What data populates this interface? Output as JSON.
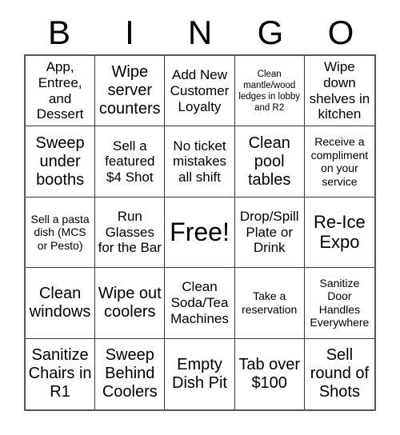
{
  "card": {
    "header_letters": [
      "B",
      "I",
      "N",
      "G",
      "O"
    ],
    "rows": [
      [
        {
          "text": "App, Entree, and Dessert",
          "size": "md"
        },
        {
          "text": "Wipe server counters",
          "size": "lg"
        },
        {
          "text": "Add New Customer Loyalty",
          "size": "md"
        },
        {
          "text": "Clean mantle/wood ledges in lobby and R2",
          "size": "xs"
        },
        {
          "text": "Wipe down shelves in kitchen",
          "size": "md"
        }
      ],
      [
        {
          "text": "Sweep under booths",
          "size": "lg"
        },
        {
          "text": "Sell a featured $4 Shot",
          "size": "md"
        },
        {
          "text": "No ticket mistakes all shift",
          "size": "md"
        },
        {
          "text": "Clean pool tables",
          "size": "lg"
        },
        {
          "text": "Receive a compliment on your service",
          "size": "sm"
        }
      ],
      [
        {
          "text": "Sell a pasta dish (MCS or Pesto)",
          "size": "sm"
        },
        {
          "text": "Run Glasses for the Bar",
          "size": "md"
        },
        {
          "text": "Free!",
          "size": "xxl"
        },
        {
          "text": "Drop/Spill Plate or Drink",
          "size": "md"
        },
        {
          "text": "Re-Ice Expo",
          "size": "xl"
        }
      ],
      [
        {
          "text": "Clean windows",
          "size": "lg"
        },
        {
          "text": "Wipe out coolers",
          "size": "lg"
        },
        {
          "text": "Clean Soda/Tea Machines",
          "size": "md"
        },
        {
          "text": "Take a reservation",
          "size": "sm"
        },
        {
          "text": "Sanitize Door Handles Everywhere",
          "size": "sm"
        }
      ],
      [
        {
          "text": "Sanitize Chairs in R1",
          "size": "lg"
        },
        {
          "text": "Sweep Behind Coolers",
          "size": "lg"
        },
        {
          "text": "Empty Dish Pit",
          "size": "lg"
        },
        {
          "text": "Tab over $100",
          "size": "lg"
        },
        {
          "text": "Sell round of Shots",
          "size": "lg"
        }
      ]
    ]
  },
  "colors": {
    "background": "#ffffff",
    "text": "#000000",
    "grid_line": "#3a3a3a",
    "grid_outline": "#555555"
  }
}
